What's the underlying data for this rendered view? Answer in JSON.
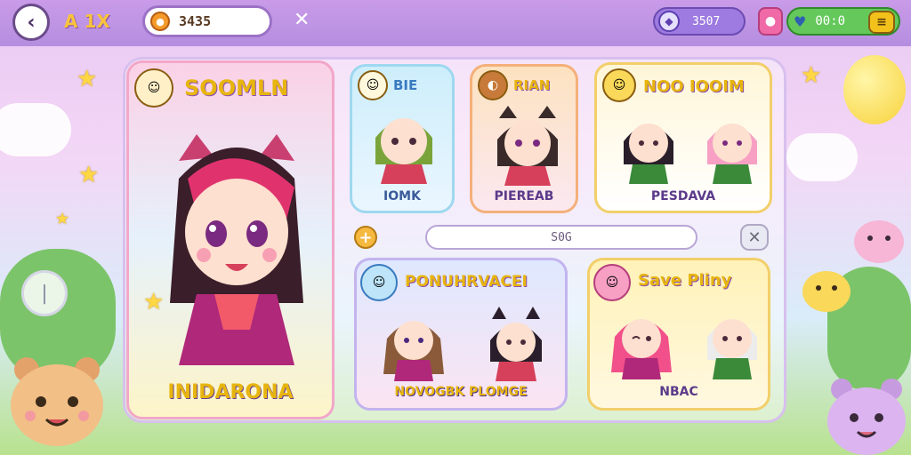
{
  "topbar": {
    "back_icon": "back-arrow-icon",
    "logo": "A 1X",
    "currency_value": "3435",
    "close_symbol": "✕",
    "gem_value": "3507",
    "timer_value": "00:0",
    "menu_symbol": "≡"
  },
  "featured": {
    "title": "SOOMLN",
    "caption": "INIDARONA"
  },
  "cards": [
    {
      "title": "BIE",
      "caption": "IOMK"
    },
    {
      "title": "RIAN",
      "caption": "PIEREAB"
    },
    {
      "title": "NOO IOOIM",
      "caption": "PESDAVA"
    },
    {
      "title": "PONUHRVACEI",
      "caption": "NOVOGBK  PLOMGE"
    },
    {
      "title": "Save Pliny",
      "caption": "NBAC"
    }
  ],
  "search": {
    "value": "S0G"
  },
  "controls": {
    "add_symbol": "+",
    "clear_symbol": "✕",
    "side_symbol": "|"
  },
  "colors": {
    "accent": "#e7b50e",
    "panel_border": "#d7c0ee",
    "topbar": "#c99be8"
  }
}
